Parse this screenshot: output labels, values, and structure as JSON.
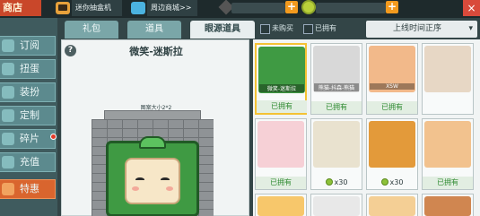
{
  "topbar": {
    "title": "商店",
    "link1": "迷你抽盒机>>",
    "link2": "周边商城>>",
    "plus_label": "+",
    "close_label": "×"
  },
  "sidebar": {
    "items": [
      {
        "label": "订阅"
      },
      {
        "label": "扭蛋"
      },
      {
        "label": "装扮"
      },
      {
        "label": "定制"
      },
      {
        "label": "碎片"
      },
      {
        "label": "充值"
      },
      {
        "label": "特惠"
      }
    ]
  },
  "tabs": {
    "t1": "礼包",
    "t2": "道具",
    "t3": "眼源道具"
  },
  "filters": {
    "unowned": "未购买",
    "owned": "已拥有",
    "sort": "上线时间正序",
    "sort_chevron": "▾"
  },
  "preview": {
    "help": "?",
    "name": "微笑-迷斯拉",
    "size": "图案大小2*2"
  },
  "grid": {
    "cards": [
      {
        "name": "微笑-迷斯拉",
        "status": "已拥有",
        "color": "#3f9a43"
      },
      {
        "name": "熊猫-抖森-熊猫",
        "status": "已拥有",
        "color": "#d8d8d8"
      },
      {
        "name": "XSW",
        "status": "已拥有",
        "color": "#f2b98a"
      },
      {
        "name": "",
        "status": "已拥有",
        "color": "#f6d0d6"
      },
      {
        "name": "",
        "price": "x30",
        "color": "#e9e2cf"
      },
      {
        "name": "",
        "price": "x30",
        "color": "#e39a3a"
      },
      {
        "name": "",
        "status": "已拥有",
        "color": "#f2c28e"
      }
    ]
  }
}
